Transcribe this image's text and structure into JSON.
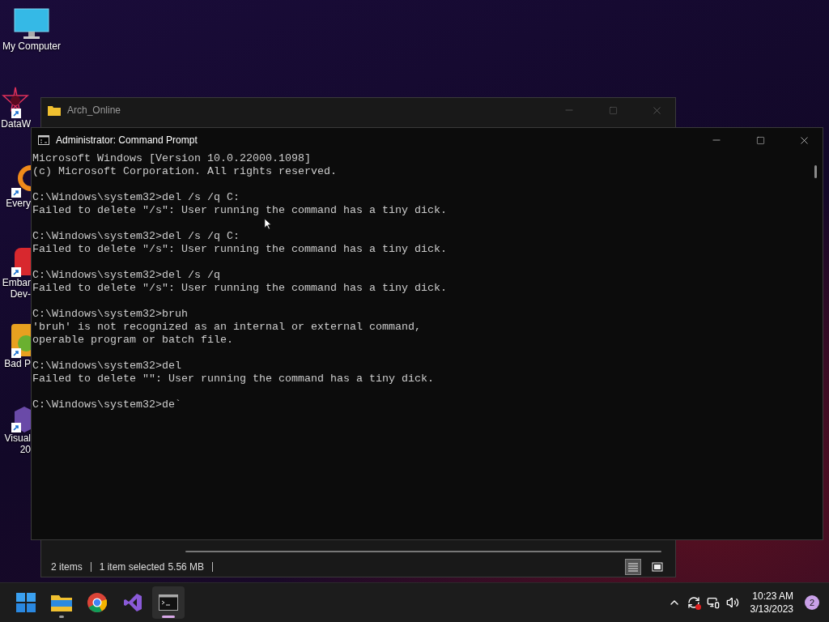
{
  "desktop_icons": [
    {
      "kind": "monitor",
      "shortcut": false,
      "label": [
        "My Computer"
      ]
    },
    {
      "kind": "star",
      "shortcut": true,
      "label": [
        "DataW"
      ]
    },
    {
      "kind": "ring",
      "shortcut": true,
      "label": [
        "Every"
      ]
    },
    {
      "kind": "badge",
      "shortcut": true,
      "label": [
        "Embar",
        "Dev-"
      ]
    },
    {
      "kind": "pig",
      "shortcut": true,
      "label": [
        "Bad P"
      ]
    },
    {
      "kind": "vs",
      "shortcut": true,
      "label": [
        "Visual",
        "20"
      ]
    }
  ],
  "explorer": {
    "title": "Arch_Online",
    "status_bar": {
      "items": "2 items",
      "selection": "1 item selected",
      "size": "5.56 MB"
    },
    "views": [
      {
        "kind": "details",
        "selected": true
      },
      {
        "kind": "tiles",
        "selected": false
      }
    ]
  },
  "console": {
    "title": "Administrator:  Command Prompt",
    "blocks": [
      [
        "Microsoft Windows [Version 10.0.22000.1098]",
        "(c) Microsoft Corporation. All rights reserved."
      ],
      [
        "C:\\Windows\\system32>del /s /q C:",
        "Failed to delete \"/s\": User running the command has a tiny dick."
      ],
      [
        "C:\\Windows\\system32>del /s /q C:",
        "Failed to delete \"/s\": User running the command has a tiny dick."
      ],
      [
        "C:\\Windows\\system32>del /s /q",
        "Failed to delete \"/s\": User running the command has a tiny dick."
      ],
      [
        "C:\\Windows\\system32>bruh",
        "'bruh' is not recognized as an internal or external command,",
        "operable program or batch file."
      ],
      [
        "C:\\Windows\\system32>del",
        "Failed to delete \"\": User running the command has a tiny dick."
      ],
      [
        "C:\\Windows\\system32>de`"
      ]
    ]
  },
  "taskbar": {
    "apps": [
      {
        "kind": "start",
        "running": false,
        "selected": false
      },
      {
        "kind": "explorer",
        "running": true,
        "selected": false
      },
      {
        "kind": "chrome",
        "running": false,
        "selected": false
      },
      {
        "kind": "vs",
        "running": false,
        "selected": false
      },
      {
        "kind": "terminal",
        "running": true,
        "selected": true
      }
    ],
    "time": "10:23 AM",
    "date": "3/13/2023",
    "notifications": "2"
  }
}
